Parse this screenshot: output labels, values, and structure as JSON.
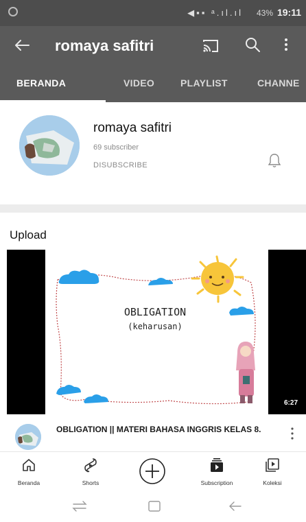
{
  "status_bar": {
    "time": "19:11",
    "battery": "43%"
  },
  "app_bar": {
    "title": "romaya safitri"
  },
  "tabs": [
    {
      "label": "BERANDA",
      "active": true
    },
    {
      "label": "VIDEO",
      "active": false
    },
    {
      "label": "PLAYLIST",
      "active": false
    },
    {
      "label": "CHANNE",
      "active": false
    }
  ],
  "channel": {
    "name": "romaya safitri",
    "subscribers": "69 subscriber",
    "unsubscribe_label": "DISUBSCRIBE"
  },
  "section": {
    "heading": "Upload"
  },
  "video": {
    "thumbnail_title": "OBLIGATION",
    "thumbnail_subtitle": "(keharusan)",
    "duration": "6:27",
    "title": "OBLIGATION || MATERI BAHASA INGGRIS KELAS 8."
  },
  "bottom_nav": [
    {
      "label": "Beranda",
      "icon": "home-icon"
    },
    {
      "label": "Shorts",
      "icon": "shorts-icon"
    },
    {
      "label": "",
      "icon": "create-icon"
    },
    {
      "label": "Subscription",
      "icon": "subscriptions-icon"
    },
    {
      "label": "Koleksi",
      "icon": "library-icon"
    }
  ],
  "colors": {
    "app_bar": "#5a5a5a",
    "status_bar": "#4d4d4d",
    "cloud": "#2a9fe8",
    "sun": "#f7c53a"
  }
}
